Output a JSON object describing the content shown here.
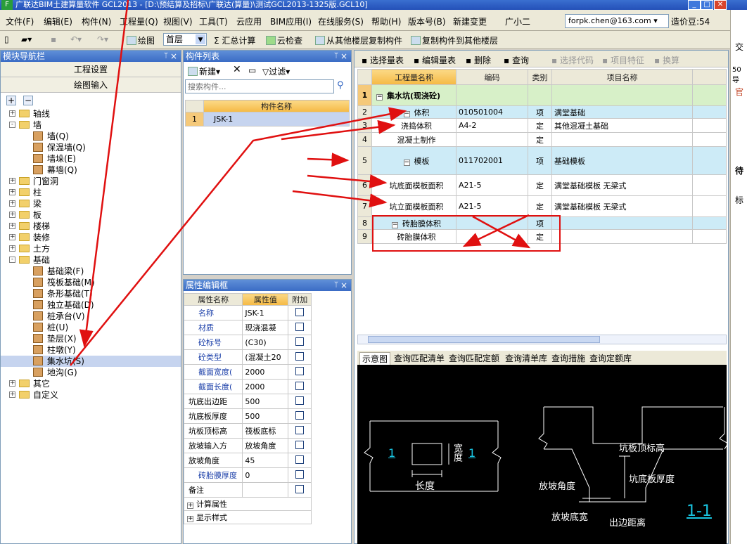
{
  "window": {
    "title": "广联达BIM土建算量软件 GCL2013 - [D:\\预结算及招标\\广联达(算量)\\测试GCL2013-1325版.GCL10]",
    "logo": "F"
  },
  "menu": [
    "文件(F)",
    "编辑(E)",
    "构件(N)",
    "工程量(Q)",
    "视图(V)",
    "工具(T)",
    "云应用",
    "BIM应用(I)",
    "在线服务(S)",
    "帮助(H)",
    "版本号(B)",
    "新建变更",
    "广小二"
  ],
  "account": {
    "email": "forpk.chen@163.com",
    "coins": "造价豆:54"
  },
  "toolbar": {
    "draw": "绘图",
    "floor": "首层",
    "sum": "汇总计算",
    "cloud_check": "云检查",
    "copy_from": "从其他楼层复制构件",
    "copy_to": "复制构件到其他楼层"
  },
  "nav": {
    "title": "模块导航栏",
    "btn_project": "工程设置",
    "btn_draw": "绘图输入",
    "tree": [
      {
        "label": "轴线",
        "level": 0,
        "expander": "+",
        "type": "folder"
      },
      {
        "label": "墙",
        "level": 0,
        "expander": "-",
        "type": "folder"
      },
      {
        "label": "墙(Q)",
        "level": 1,
        "type": "leaf"
      },
      {
        "label": "保温墙(Q)",
        "level": 1,
        "type": "leaf"
      },
      {
        "label": "墙垛(E)",
        "level": 1,
        "type": "leaf"
      },
      {
        "label": "幕墙(Q)",
        "level": 1,
        "type": "leaf"
      },
      {
        "label": "门窗洞",
        "level": 0,
        "expander": "+",
        "type": "folder"
      },
      {
        "label": "柱",
        "level": 0,
        "expander": "+",
        "type": "folder"
      },
      {
        "label": "梁",
        "level": 0,
        "expander": "+",
        "type": "folder"
      },
      {
        "label": "板",
        "level": 0,
        "expander": "+",
        "type": "folder"
      },
      {
        "label": "楼梯",
        "level": 0,
        "expander": "+",
        "type": "folder"
      },
      {
        "label": "装修",
        "level": 0,
        "expander": "+",
        "type": "folder"
      },
      {
        "label": "土方",
        "level": 0,
        "expander": "+",
        "type": "folder"
      },
      {
        "label": "基础",
        "level": 0,
        "expander": "-",
        "type": "folder"
      },
      {
        "label": "基础梁(F)",
        "level": 1,
        "type": "leaf"
      },
      {
        "label": "筏板基础(M)",
        "level": 1,
        "type": "leaf"
      },
      {
        "label": "条形基础(T)",
        "level": 1,
        "type": "leaf"
      },
      {
        "label": "独立基础(D)",
        "level": 1,
        "type": "leaf"
      },
      {
        "label": "桩承台(V)",
        "level": 1,
        "type": "leaf"
      },
      {
        "label": "桩(U)",
        "level": 1,
        "type": "leaf"
      },
      {
        "label": "垫层(X)",
        "level": 1,
        "type": "leaf"
      },
      {
        "label": "柱墩(Y)",
        "level": 1,
        "type": "leaf"
      },
      {
        "label": "集水坑(S)",
        "level": 1,
        "type": "leaf",
        "selected": true
      },
      {
        "label": "地沟(G)",
        "level": 1,
        "type": "leaf"
      },
      {
        "label": "其它",
        "level": 0,
        "expander": "+",
        "type": "folder"
      },
      {
        "label": "自定义",
        "level": 0,
        "expander": "+",
        "type": "folder"
      }
    ]
  },
  "comp": {
    "title": "构件列表",
    "new": "新建",
    "filter": "过滤",
    "search_placeholder": "搜索构件...",
    "col": "构件名称",
    "rows": [
      {
        "no": "1",
        "name": "JSK-1"
      }
    ]
  },
  "props": {
    "title": "属性编辑框",
    "cols": [
      "属性名称",
      "属性值",
      "附加"
    ],
    "rows": [
      {
        "name": "名称",
        "value": "JSK-1",
        "blue": true
      },
      {
        "name": "材质",
        "value": "现浇混凝",
        "blue": true
      },
      {
        "name": "砼标号",
        "value": "(C30)",
        "blue": true
      },
      {
        "name": "砼类型",
        "value": "(混凝土20",
        "blue": true
      },
      {
        "name": "截面宽度(",
        "value": "2000",
        "blue": true
      },
      {
        "name": "截面长度(",
        "value": "2000",
        "blue": true
      },
      {
        "name": "坑底出边距",
        "value": "500"
      },
      {
        "name": "坑底板厚度",
        "value": "500"
      },
      {
        "name": "坑板顶标高",
        "value": "筏板底标"
      },
      {
        "name": "放坡输入方",
        "value": "放坡角度"
      },
      {
        "name": "放坡角度",
        "value": "45"
      },
      {
        "name": "砖胎膜厚度",
        "value": "0",
        "blue": true
      },
      {
        "name": "备注",
        "value": ""
      }
    ],
    "groups": [
      "计算属性",
      "显示样式"
    ]
  },
  "qty": {
    "toolbar": [
      "选择量表",
      "编辑量表",
      "删除",
      "查询",
      "选择代码",
      "项目特征",
      "换算"
    ],
    "cols": [
      "工程量名称",
      "编码",
      "类别",
      "项目名称"
    ],
    "rows": [
      {
        "no": "1",
        "name": "集水坑(现浇砼)",
        "code": "",
        "cat": "",
        "item": "",
        "kind": "top"
      },
      {
        "no": "2",
        "name": "体积",
        "code": "010501004",
        "cat": "项",
        "item": "满堂基础",
        "kind": "sec"
      },
      {
        "no": "3",
        "name": "浇捣体积",
        "code": "A4-2",
        "cat": "定",
        "item": "其他混凝土基础",
        "kind": "sub"
      },
      {
        "no": "4",
        "name": "混凝土制作",
        "code": "",
        "cat": "定",
        "item": "",
        "kind": "sub"
      },
      {
        "no": "5",
        "name": "模板",
        "code": "011702001",
        "cat": "项",
        "item": "基础模板",
        "kind": "sec"
      },
      {
        "no": "6",
        "name": "坑底面模板面积",
        "code": "A21-5",
        "cat": "定",
        "item": "满堂基础模板 无梁式",
        "kind": "sub"
      },
      {
        "no": "7",
        "name": "坑立面模板面积",
        "code": "A21-5",
        "cat": "定",
        "item": "满堂基础模板 无梁式",
        "kind": "sub"
      },
      {
        "no": "8",
        "name": "砖胎膜体积",
        "code": "",
        "cat": "项",
        "item": "",
        "kind": "sec"
      },
      {
        "no": "9",
        "name": "砖胎膜体积",
        "code": "",
        "cat": "定",
        "item": "",
        "kind": "sub"
      }
    ]
  },
  "tabs": [
    "示意图",
    "查询匹配清单",
    "查询匹配定额",
    "查询清单库",
    "查询措施",
    "查询定额库"
  ],
  "diagram": {
    "one": "1",
    "width": "宽度",
    "length": "长度",
    "top_elev": "坑板顶标高",
    "slope_angle": "放坡角度",
    "bottom_thick": "坑底板厚度",
    "slope_bottom": "放坡底宽",
    "out_edge": "出边距离",
    "section": "1-1"
  },
  "strip": [
    "交",
    "50导",
    "官",
    "待",
    "标"
  ],
  "colors": {
    "annotation": "#e01010",
    "header": "#f5b944",
    "section": "#cdebf7"
  }
}
